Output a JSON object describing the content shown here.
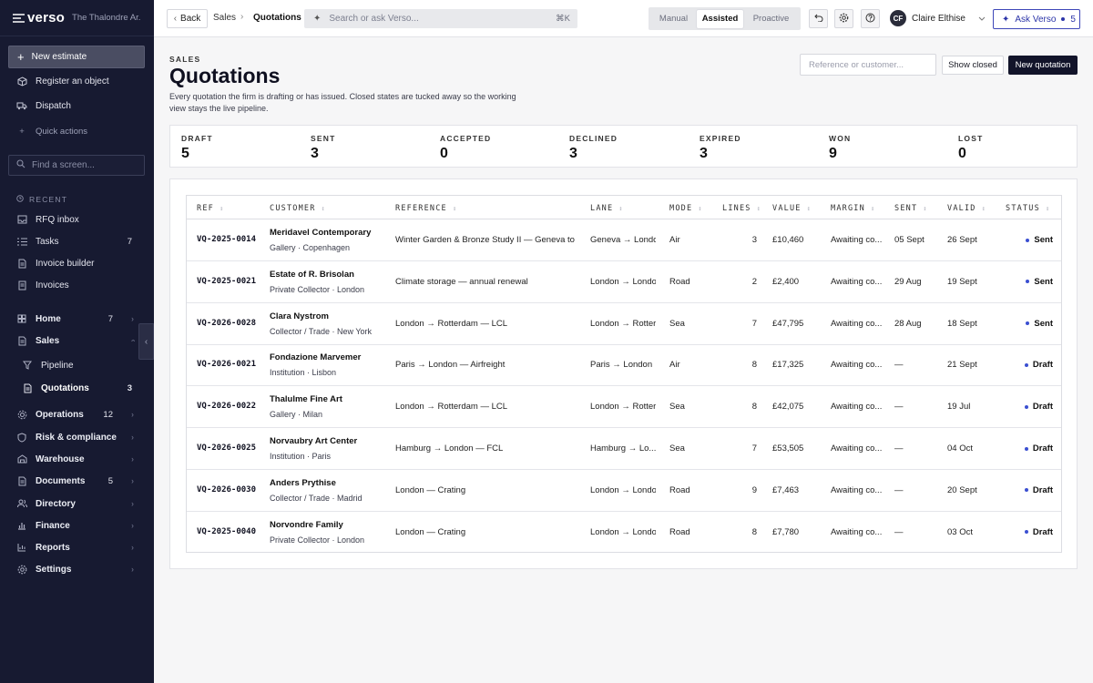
{
  "app": {
    "brand": "verso",
    "org": "The Thalondre Ar..."
  },
  "sidebar": {
    "primary_action": "New estimate",
    "actions": [
      "Register an object",
      "Dispatch"
    ],
    "quick_actions": "Quick actions",
    "search_placeholder": "Find a screen...",
    "recent_label": "RECENT",
    "recent": [
      {
        "label": "RFQ inbox",
        "count": ""
      },
      {
        "label": "Tasks",
        "count": "7"
      },
      {
        "label": "Invoice builder",
        "count": ""
      },
      {
        "label": "Invoices",
        "count": ""
      }
    ],
    "nav": [
      {
        "label": "Home",
        "count": "7"
      },
      {
        "label": "Sales",
        "count": ""
      },
      {
        "label": "Pipeline",
        "count": ""
      },
      {
        "label": "Quotations",
        "count": "3"
      },
      {
        "label": "Operations",
        "count": "12"
      },
      {
        "label": "Risk & compliance",
        "count": ""
      },
      {
        "label": "Warehouse",
        "count": ""
      },
      {
        "label": "Documents",
        "count": "5"
      },
      {
        "label": "Directory",
        "count": ""
      },
      {
        "label": "Finance",
        "count": ""
      },
      {
        "label": "Reports",
        "count": ""
      },
      {
        "label": "Settings",
        "count": ""
      }
    ]
  },
  "topbar": {
    "back": "Back",
    "breadcrumb": [
      "Sales",
      "Quotations"
    ],
    "search_placeholder": "Search or ask Verso...",
    "search_shortcut": "⌘K",
    "modes": [
      "Manual",
      "Assisted",
      "Proactive"
    ],
    "active_mode": "Assisted",
    "user_initials": "CF",
    "user_name": "Claire Elthise",
    "ask_label": "Ask Verso",
    "ask_count": "5"
  },
  "page": {
    "eyebrow": "SALES",
    "title": "Quotations",
    "description": "Every quotation the firm is drafting or has issued. Closed states are tucked away so the working view stays the live pipeline.",
    "filter_placeholder": "Reference or customer...",
    "show_closed": "Show closed",
    "new_quotation": "New quotation"
  },
  "stats": [
    {
      "label": "DRAFT",
      "value": "5"
    },
    {
      "label": "SENT",
      "value": "3"
    },
    {
      "label": "ACCEPTED",
      "value": "0"
    },
    {
      "label": "DECLINED",
      "value": "3"
    },
    {
      "label": "EXPIRED",
      "value": "3"
    },
    {
      "label": "WON",
      "value": "9"
    },
    {
      "label": "LOST",
      "value": "0"
    }
  ],
  "table": {
    "columns": [
      "REF",
      "CUSTOMER",
      "REFERENCE",
      "LANE",
      "MODE",
      "LINES",
      "VALUE",
      "MARGIN",
      "SENT",
      "VALID",
      "STATUS"
    ],
    "sort_glyph": "↕",
    "rows": [
      {
        "ref": "VQ-2025-0014",
        "customer": "Meridavel Contemporary",
        "customer_sub": "Gallery · Copenhagen",
        "reference": "Winter Garden & Bronze Study II — Geneva to ...",
        "lane": "Geneva → London...",
        "mode": "Air",
        "lines": "3",
        "value": "£10,460",
        "margin": "Awaiting co...",
        "sent": "05 Sept",
        "valid": "26 Sept",
        "status": "Sent"
      },
      {
        "ref": "VQ-2025-0021",
        "customer": "Estate of R. Brisolan",
        "customer_sub": "Private Collector · London",
        "reference": "Climate storage — annual renewal",
        "lane": "London → London...",
        "mode": "Road",
        "lines": "2",
        "value": "£2,400",
        "margin": "Awaiting co...",
        "sent": "29 Aug",
        "valid": "19 Sept",
        "status": "Sent"
      },
      {
        "ref": "VQ-2026-0028",
        "customer": "Clara Nystrom",
        "customer_sub": "Collector / Trade · New York",
        "reference": "London → Rotterdam — LCL",
        "lane": "London → Rotter...",
        "mode": "Sea",
        "lines": "7",
        "value": "£47,795",
        "margin": "Awaiting co...",
        "sent": "28 Aug",
        "valid": "18 Sept",
        "status": "Sent"
      },
      {
        "ref": "VQ-2026-0021",
        "customer": "Fondazione Marvemer",
        "customer_sub": "Institution · Lisbon",
        "reference": "Paris → London — Airfreight",
        "lane": "Paris → London",
        "mode": "Air",
        "lines": "8",
        "value": "£17,325",
        "margin": "Awaiting co...",
        "sent": "—",
        "valid": "21 Sept",
        "status": "Draft"
      },
      {
        "ref": "VQ-2026-0022",
        "customer": "Thalulme Fine Art",
        "customer_sub": "Gallery · Milan",
        "reference": "London → Rotterdam — LCL",
        "lane": "London → Rotter...",
        "mode": "Sea",
        "lines": "8",
        "value": "£42,075",
        "margin": "Awaiting co...",
        "sent": "—",
        "valid": "19 Jul",
        "status": "Draft"
      },
      {
        "ref": "VQ-2026-0025",
        "customer": "Norvaubry Art Center",
        "customer_sub": "Institution · Paris",
        "reference": "Hamburg → London — FCL",
        "lane": "Hamburg → Lo...",
        "mode": "Sea",
        "lines": "7",
        "value": "£53,505",
        "margin": "Awaiting co...",
        "sent": "—",
        "valid": "04 Oct",
        "status": "Draft"
      },
      {
        "ref": "VQ-2026-0030",
        "customer": "Anders Prythise",
        "customer_sub": "Collector / Trade · Madrid",
        "reference": "London — Crating",
        "lane": "London → London...",
        "mode": "Road",
        "lines": "9",
        "value": "£7,463",
        "margin": "Awaiting co...",
        "sent": "—",
        "valid": "20 Sept",
        "status": "Draft"
      },
      {
        "ref": "VQ-2025-0040",
        "customer": "Norvondre Family",
        "customer_sub": "Private Collector · London",
        "reference": "London — Crating",
        "lane": "London → London...",
        "mode": "Road",
        "lines": "8",
        "value": "£7,780",
        "margin": "Awaiting co...",
        "sent": "—",
        "valid": "03 Oct",
        "status": "Draft"
      }
    ]
  }
}
